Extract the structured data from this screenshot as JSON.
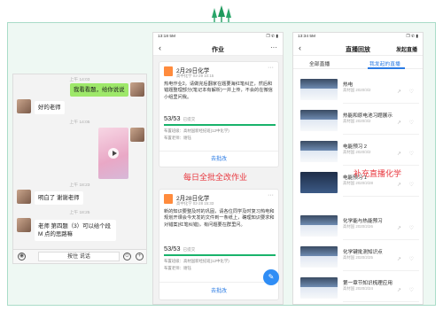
{
  "chat": {
    "messages": [
      {
        "side": "me",
        "text": "我看看题，给你说说"
      },
      {
        "side": "other",
        "text": "好的老师"
      },
      {
        "side": "other",
        "text": "明白了 谢谢老师"
      },
      {
        "side": "other",
        "text": "老师 第四题（3）可以给个段 M 点的思路嘛"
      }
    ],
    "timestamps": [
      "上午 14:03",
      "上午 14:05",
      "上午 18:23",
      "上午 18:25"
    ],
    "voice_button": "按住 说话"
  },
  "homework": {
    "status_time": "13:18 5M",
    "status_right": "❐ ✆ ▮",
    "title": "作业",
    "cards": [
      {
        "title": "2月29日化学",
        "meta": "高中化学  02-29 10:15",
        "body": "热电作业2。请做完后翻家在题要海红笔纠正，然后和错题整理部分(笔记本有解析)一并上传，不会的在微信小组里问我。",
        "score": "53/53",
        "score_label": "已提交",
        "progress": 1.0,
        "info1": "布置班级：高材国新经纪班(12中化学)",
        "info2": "布置老师：谢钰",
        "action": "去批改"
      },
      {
        "title": "2月28日化学",
        "meta": "高中化学  02-28 15:33",
        "body": "新的知识要整及时的巩固，请各位同学及时复习热电和规划开课会今天发的文件到一条纸上，确理知识要求和对错案(红笔纠错)，有问题要在群里问。",
        "score": "53/53",
        "score_label": "已提交",
        "progress": 1.0,
        "info1": "布置班级：高材国新经纪班(12中化学)",
        "info2": "布置老师：谢钰",
        "action": "去批改"
      }
    ],
    "caption": "每日全批全改作业"
  },
  "replay": {
    "status_time": "13:34 5M",
    "title": "直播回放",
    "right_action": "发起直播",
    "tabs": [
      "全部直播",
      "我发起的直播"
    ],
    "items": [
      {
        "title": "热电",
        "meta": "高材国   2020/3/2"
      },
      {
        "title": "热能和原电池习题展示",
        "meta": "高材国   2020/3/2"
      },
      {
        "title": "电能预习 2",
        "meta": "高材国   2020/3/2"
      },
      {
        "title": "电能预习 1",
        "meta": "高材国   2020/2/28"
      },
      {
        "title": "化学能与热能预习",
        "meta": "高材国   2020/2/26"
      },
      {
        "title": "化学键批测知识点",
        "meta": "高材国   2020/2/25"
      },
      {
        "title": "第一章节知识梳理应用",
        "meta": "高材国   2020/2/24"
      }
    ],
    "caption": "补充直播化学"
  },
  "colors": {
    "accent": "#2a7be4",
    "green": "#19b36b",
    "caption_red": "#e8373e",
    "frame": "#a9dcc8"
  }
}
